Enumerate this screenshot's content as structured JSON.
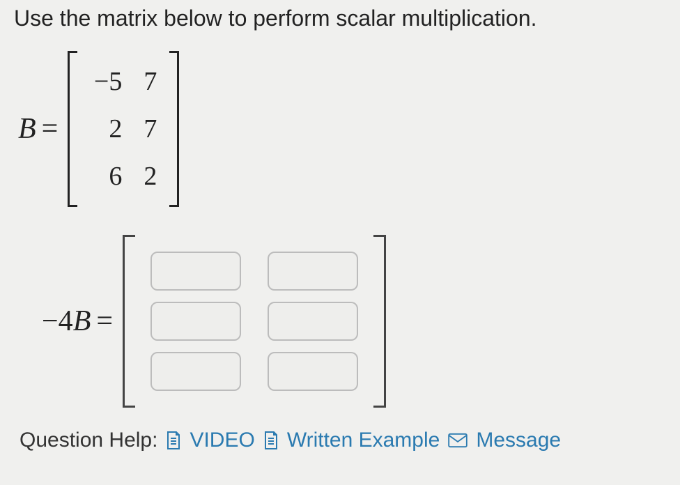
{
  "prompt": "Use the matrix below to perform scalar multiplication.",
  "matrixB": {
    "lhs_var": "B",
    "eq": "=",
    "rows": [
      [
        "−5",
        "7"
      ],
      [
        "2",
        "7"
      ],
      [
        "6",
        "2"
      ]
    ]
  },
  "answer": {
    "scalar_prefix": "−4",
    "lhs_var": "B",
    "eq": "=",
    "inputs": [
      [
        "",
        ""
      ],
      [
        "",
        ""
      ],
      [
        "",
        ""
      ]
    ]
  },
  "help": {
    "label": "Question Help:",
    "video": "VIDEO",
    "written": "Written Example",
    "message": "Message"
  }
}
